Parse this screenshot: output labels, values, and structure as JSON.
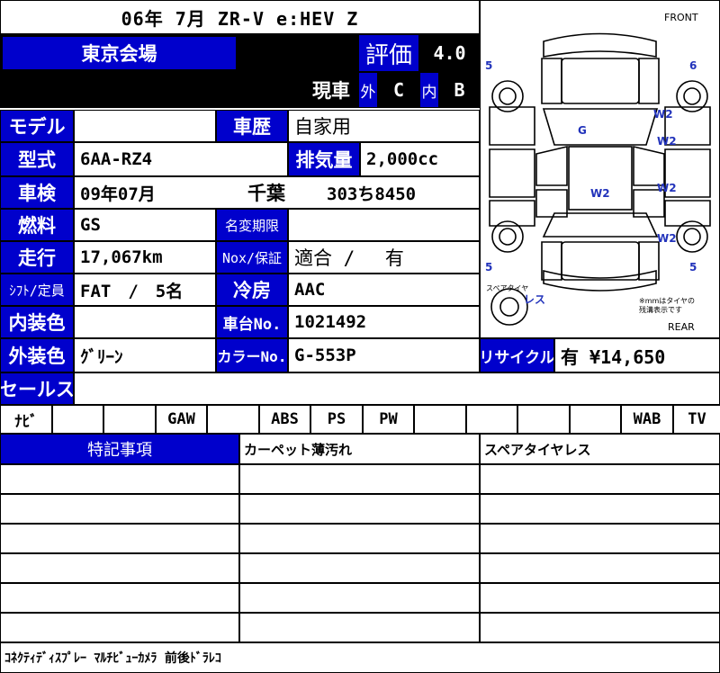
{
  "title": "06年 7月 ZR-V e:HEV Z",
  "venue": "東京会場",
  "rating_label": "評価",
  "rating_value": "4.0",
  "status": "現車",
  "exterior_label": "外",
  "exterior_grade": "C",
  "interior_label": "内",
  "interior_grade": "B",
  "fields": {
    "model_label": "モデル",
    "model_value": "",
    "history_label": "車歴",
    "history_value": "自家用",
    "type_label": "型式",
    "type_value": "6AA-RZ4",
    "displacement_label": "排気量",
    "displacement_value": "2,000cc",
    "inspection_label": "車検",
    "inspection_value": "09年07月",
    "plate_region": "千葉",
    "plate_number": "303ち8450",
    "fuel_label": "燃料",
    "fuel_value": "GS",
    "transfer_label": "名変期限",
    "transfer_value": "",
    "mileage_label": "走行",
    "mileage_value": "17,067km",
    "nox_label": "Nox/保証",
    "nox_value": "適合 /　 有",
    "shift_label": "ｼﾌﾄ/定員",
    "shift_value": "FAT　/　5名",
    "ac_label": "冷房",
    "ac_value": "AAC",
    "interior_color_label": "内装色",
    "interior_color_value": "",
    "chassis_label": "車台No.",
    "chassis_value": "1021492",
    "exterior_color_label": "外装色",
    "exterior_color_value": "ｸﾞﾘｰﾝ",
    "color_no_label": "カラーNo.",
    "color_no_value": "G-553P",
    "recycle_label": "リサイクル",
    "recycle_value": "有 ¥14,650",
    "sales_label": "セールス",
    "sales_value": ""
  },
  "equipment": [
    "ﾅﾋﾞ",
    "",
    "",
    "GAW",
    "",
    "ABS",
    "PS",
    "PW",
    "",
    "",
    "",
    "",
    "WAB",
    "TV"
  ],
  "notes_header": "特記事項",
  "note_column_2": "カーペット薄汚れ",
  "note_column_3": "スペアタイヤレス",
  "footer_text": "ｺﾈｸﾃｨﾃﾞｨｽﾌﾟﾚｰ ﾏﾙﾁﾋﾞｭｰｶﾒﾗ 前後ﾄﾞﾗﾚｺ",
  "diagram": {
    "front_label": "FRONT",
    "rear_label": "REAR",
    "marks": {
      "fl": "5",
      "fr": "6",
      "rl": "5",
      "rr": "5",
      "g": "G",
      "w2a": "W2",
      "w2b": "W2",
      "w2c": "W2",
      "w2d": "W2",
      "w2e": "W2",
      "spare": "スペアタイヤ",
      "less": "レス",
      "note": "※mmはタイヤの\n残溝表示です"
    }
  },
  "colors": {
    "header_blue": "#0000cc",
    "mark_blue": "#2233bb",
    "black": "#000000"
  }
}
